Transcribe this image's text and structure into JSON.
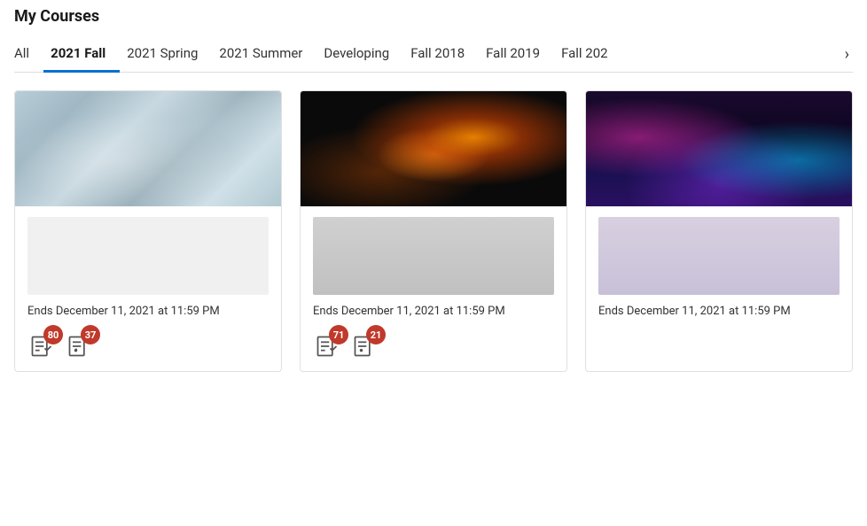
{
  "page": {
    "title": "My Courses"
  },
  "tabs": {
    "items": [
      {
        "label": "All",
        "active": false
      },
      {
        "label": "2021 Fall",
        "active": true
      },
      {
        "label": "2021 Spring",
        "active": false
      },
      {
        "label": "2021 Summer",
        "active": false
      },
      {
        "label": "Developing",
        "active": false
      },
      {
        "label": "Fall 2018",
        "active": false
      },
      {
        "label": "Fall 2019",
        "active": false
      },
      {
        "label": "Fall 202",
        "active": false
      }
    ],
    "chevron": "›"
  },
  "courses": [
    {
      "id": "course-1",
      "image_style": "snowflake",
      "end_date": "Ends December 11, 2021 at 11:59 PM",
      "actions": [
        {
          "icon": "grades-icon",
          "badge": "80"
        },
        {
          "icon": "questions-icon",
          "badge": "37"
        }
      ]
    },
    {
      "id": "course-2",
      "image_style": "sparks",
      "end_date": "Ends December 11, 2021 at 11:59 PM",
      "actions": [
        {
          "icon": "grades-icon",
          "badge": "71"
        },
        {
          "icon": "questions-icon",
          "badge": "21"
        }
      ]
    },
    {
      "id": "course-3",
      "image_style": "waves",
      "end_date": "Ends December 11, 2021 at 11:59 PM",
      "actions": []
    }
  ]
}
